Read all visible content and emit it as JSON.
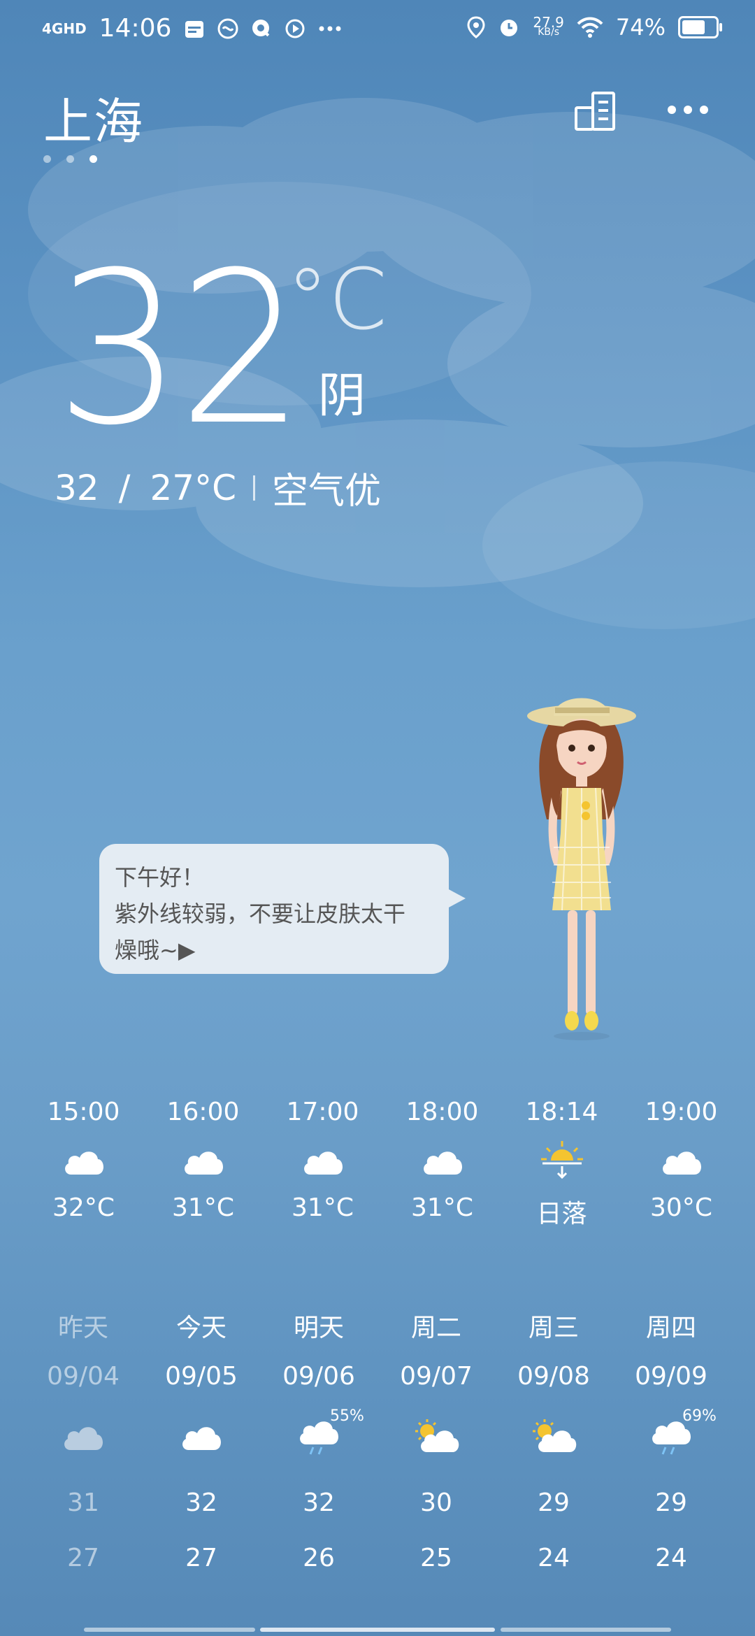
{
  "status_bar": {
    "network": "4GHD",
    "time": "14:06",
    "speed_value": "27.9",
    "speed_unit": "KB/s",
    "battery": "74%",
    "battery_level": 0.74
  },
  "header": {
    "city": "上海",
    "page_count": 3,
    "active_page": 2
  },
  "current": {
    "temperature": "32",
    "unit": "°C",
    "condition": "阴",
    "high": "32",
    "range_sep": "/",
    "low": "27°C",
    "air_quality": "空气优"
  },
  "bubble": {
    "line1": "下午好！",
    "line2": "紫外线较弱，不要让皮肤太干",
    "line3": "燥哦~▶"
  },
  "hourly": [
    {
      "time": "15:00",
      "icon": "cloud-icon",
      "value": "32°C"
    },
    {
      "time": "16:00",
      "icon": "cloud-icon",
      "value": "31°C"
    },
    {
      "time": "17:00",
      "icon": "cloud-icon",
      "value": "31°C"
    },
    {
      "time": "18:00",
      "icon": "cloud-icon",
      "value": "31°C"
    },
    {
      "time": "18:14",
      "icon": "sunset-icon",
      "value": "日落"
    },
    {
      "time": "19:00",
      "icon": "cloud-icon",
      "value": "30°C"
    }
  ],
  "daily": [
    {
      "name": "昨天",
      "date": "09/04",
      "icon": "cloud-icon",
      "pop": "",
      "high": "31",
      "low": "27"
    },
    {
      "name": "今天",
      "date": "09/05",
      "icon": "cloud-icon",
      "pop": "",
      "high": "32",
      "low": "27"
    },
    {
      "name": "明天",
      "date": "09/06",
      "icon": "rain-cloud-icon",
      "pop": "55%",
      "high": "32",
      "low": "26"
    },
    {
      "name": "周二",
      "date": "09/07",
      "icon": "partly-cloudy-icon",
      "pop": "",
      "high": "30",
      "low": "25"
    },
    {
      "name": "周三",
      "date": "09/08",
      "icon": "partly-cloudy-icon",
      "pop": "",
      "high": "29",
      "low": "24"
    },
    {
      "name": "周四",
      "date": "09/09",
      "icon": "rain-cloud-icon",
      "pop": "69%",
      "high": "29",
      "low": "24"
    }
  ],
  "colors": {
    "sun": "#f4c430",
    "rain": "#7ec3f5"
  }
}
